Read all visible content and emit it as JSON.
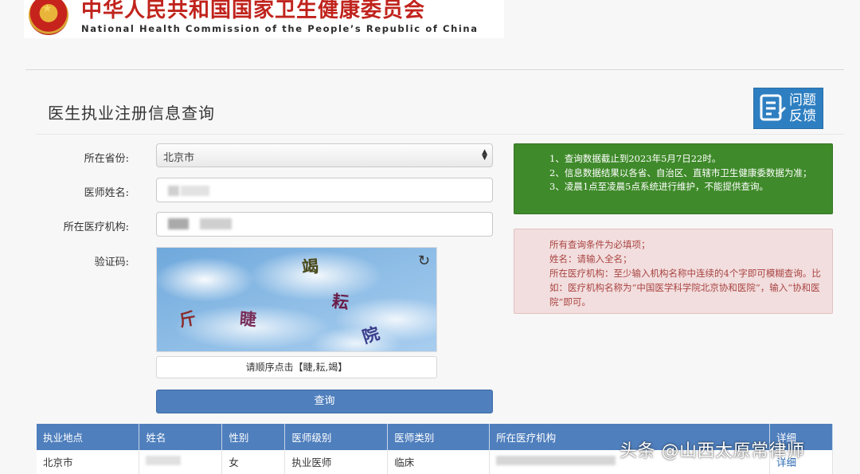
{
  "header": {
    "org_cn": "中华人民共和国国家卫生健康委员会",
    "org_en": "National Health Commission of the People’s Republic of China"
  },
  "page": {
    "title": "医生执业注册信息查询",
    "feedback_label_line1": "问题",
    "feedback_label_line2": "反馈"
  },
  "form": {
    "province_label": "所在省份:",
    "province_value": "北京市",
    "name_label": "医师姓名:",
    "org_label": "所在医疗机构:",
    "captcha_label": "验证码:",
    "captcha_chars": [
      "竭",
      "耘",
      "斤",
      "睫",
      "院"
    ],
    "captcha_hint": "请顺序点击【睫,耘,竭】",
    "submit_label": "查询"
  },
  "notice_info": {
    "lines": [
      "1、查询数据截止到2023年5月7日22时。",
      "2、信息数据结果以各省、自治区、直辖市卫生健康委数据为准；",
      "3、凌晨1点至凌晨5点系统进行维护，不能提供查询。"
    ]
  },
  "notice_warning": {
    "lines": [
      "所有查询条件为必填项；",
      "姓名：请输入全名；",
      "所在医疗机构：至少输入机构名称中连续的4个字即可模糊查询。比如：医疗机构名称为“中国医学科学院北京协和医院”，输入“协和医院”即可。"
    ]
  },
  "results_table": {
    "columns": [
      "执业地点",
      "姓名",
      "性别",
      "医师级别",
      "医师类别",
      "所在医疗机构",
      "详细"
    ],
    "rows": [
      {
        "location": "北京市",
        "name": "",
        "gender": "女",
        "level": "执业医师",
        "category": "临床",
        "org": "",
        "detail": "详细"
      }
    ]
  },
  "watermark": "头条 @山西太原常律师",
  "colors": {
    "banner_red": "#c0231c",
    "primary_blue": "#4f7fbd",
    "info_green": "#3f8a2a",
    "warning_bg": "#f2dede",
    "warning_text": "#a94442"
  }
}
